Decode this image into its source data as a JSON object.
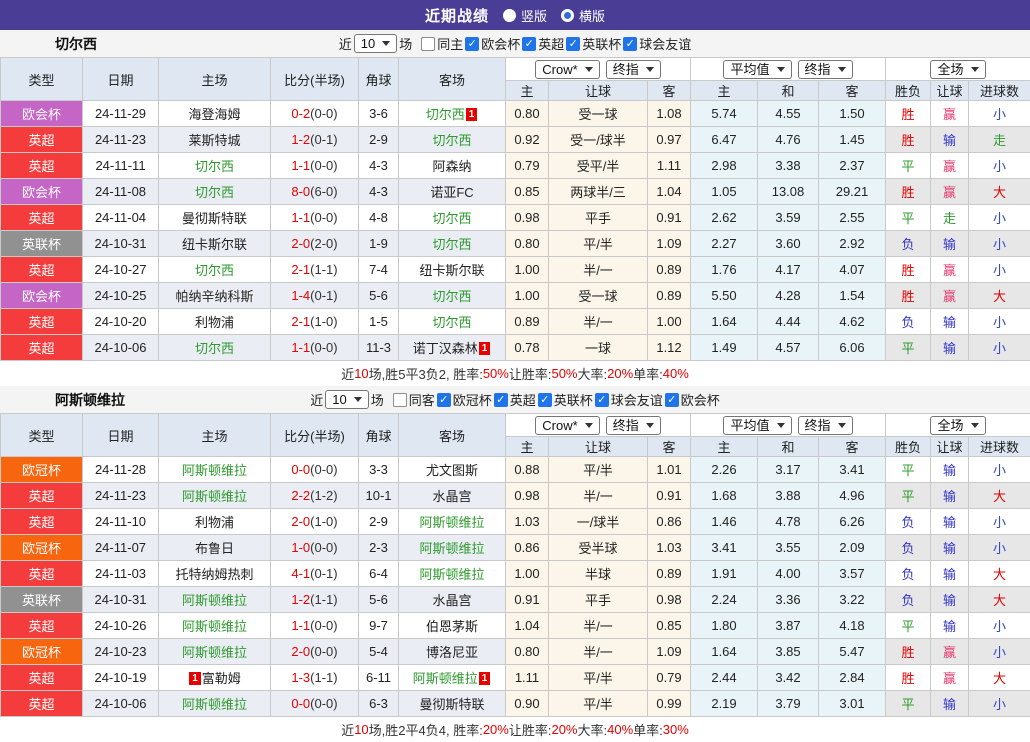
{
  "topbar": {
    "title": "近期战绩",
    "radio_vertical": "竖版",
    "radio_horizontal": "横版",
    "selected_layout": "横版"
  },
  "filters_common": {
    "near": "近",
    "count": "10",
    "unit": "场"
  },
  "table_headers": {
    "type": "类型",
    "date": "日期",
    "home": "主场",
    "score": "比分(半场)",
    "corner": "角球",
    "away": "客场",
    "bookmaker": "Crow*",
    "final_odds": "终指",
    "average": "平均值",
    "final_odds2": "终指",
    "fulltime": "全场",
    "home_odds": "主",
    "handicap": "让球",
    "away_odds": "客",
    "home_avg": "主",
    "draw_avg": "和",
    "away_avg": "客",
    "result": "胜负",
    "handicap_result": "让球",
    "goals": "进球数"
  },
  "colors": {
    "topbar_bg": "#4a3d96",
    "league": {
      "欧会杯": "#c565c5",
      "英超": "#f43c3c",
      "英联杯": "#919191",
      "欧冠杯": "#f7650f"
    },
    "result": {
      "胜": "#e60000",
      "平": "#2e9b2e",
      "负": "#3333cc"
    },
    "handicap": {
      "赢": "#e63c6e",
      "输": "#3333cc",
      "走": "#2e9b2e"
    },
    "goals": {
      "大": "#e60000",
      "小": "#3344cc",
      "走": "#2e9b2e"
    },
    "team_highlight": "#2e9b2e",
    "score_red": "#e60000",
    "badge_red": "#e60000"
  },
  "sections": [
    {
      "team": "切尔西",
      "same_venue": "同主",
      "same_checked": false,
      "leagues": [
        "欧会杯",
        "英超",
        "英联杯",
        "球会友谊"
      ],
      "rows": [
        {
          "league": "欧会杯",
          "date": "24-11-29",
          "home": "海登海姆",
          "home_hl": false,
          "score": "0-2",
          "half": "(0-0)",
          "corner": "3-6",
          "away": "切尔西",
          "away_hl": true,
          "away_badge": "1",
          "away_badge_pos": "after",
          "odds": [
            "0.80",
            "受一球",
            "1.08"
          ],
          "avg": [
            "5.74",
            "4.55",
            "1.50"
          ],
          "result": "胜",
          "handicap": "赢",
          "goals": "小"
        },
        {
          "league": "英超",
          "date": "24-11-23",
          "home": "莱斯特城",
          "home_hl": false,
          "score": "1-2",
          "half": "(0-1)",
          "corner": "2-9",
          "away": "切尔西",
          "away_hl": true,
          "odds": [
            "0.92",
            "受一/球半",
            "0.97"
          ],
          "avg": [
            "6.47",
            "4.76",
            "1.45"
          ],
          "result": "胜",
          "handicap": "输",
          "goals": "走"
        },
        {
          "league": "英超",
          "date": "24-11-11",
          "home": "切尔西",
          "home_hl": true,
          "score": "1-1",
          "half": "(0-0)",
          "corner": "4-3",
          "away": "阿森纳",
          "away_hl": false,
          "odds": [
            "0.79",
            "受平/半",
            "1.11"
          ],
          "avg": [
            "2.98",
            "3.38",
            "2.37"
          ],
          "result": "平",
          "handicap": "赢",
          "goals": "小"
        },
        {
          "league": "欧会杯",
          "date": "24-11-08",
          "home": "切尔西",
          "home_hl": true,
          "score": "8-0",
          "half": "(6-0)",
          "corner": "4-3",
          "away": "诺亚FC",
          "away_hl": false,
          "odds": [
            "0.85",
            "两球半/三",
            "1.04"
          ],
          "avg": [
            "1.05",
            "13.08",
            "29.21"
          ],
          "result": "胜",
          "handicap": "赢",
          "goals": "大"
        },
        {
          "league": "英超",
          "date": "24-11-04",
          "home": "曼彻斯特联",
          "home_hl": false,
          "score": "1-1",
          "half": "(0-0)",
          "corner": "4-8",
          "away": "切尔西",
          "away_hl": true,
          "odds": [
            "0.98",
            "平手",
            "0.91"
          ],
          "avg": [
            "2.62",
            "3.59",
            "2.55"
          ],
          "result": "平",
          "handicap": "走",
          "goals": "小"
        },
        {
          "league": "英联杯",
          "date": "24-10-31",
          "home": "纽卡斯尔联",
          "home_hl": false,
          "score": "2-0",
          "half": "(2-0)",
          "corner": "1-9",
          "away": "切尔西",
          "away_hl": true,
          "odds": [
            "0.80",
            "平/半",
            "1.09"
          ],
          "avg": [
            "2.27",
            "3.60",
            "2.92"
          ],
          "result": "负",
          "handicap": "输",
          "goals": "小"
        },
        {
          "league": "英超",
          "date": "24-10-27",
          "home": "切尔西",
          "home_hl": true,
          "score": "2-1",
          "half": "(1-1)",
          "corner": "7-4",
          "away": "纽卡斯尔联",
          "away_hl": false,
          "odds": [
            "1.00",
            "半/一",
            "0.89"
          ],
          "avg": [
            "1.76",
            "4.17",
            "4.07"
          ],
          "result": "胜",
          "handicap": "赢",
          "goals": "小"
        },
        {
          "league": "欧会杯",
          "date": "24-10-25",
          "home": "帕纳辛纳科斯",
          "home_hl": false,
          "score": "1-4",
          "half": "(0-1)",
          "corner": "5-6",
          "away": "切尔西",
          "away_hl": true,
          "odds": [
            "1.00",
            "受一球",
            "0.89"
          ],
          "avg": [
            "5.50",
            "4.28",
            "1.54"
          ],
          "result": "胜",
          "handicap": "赢",
          "goals": "大"
        },
        {
          "league": "英超",
          "date": "24-10-20",
          "home": "利物浦",
          "home_hl": false,
          "score": "2-1",
          "half": "(1-0)",
          "corner": "1-5",
          "away": "切尔西",
          "away_hl": true,
          "odds": [
            "0.89",
            "半/一",
            "1.00"
          ],
          "avg": [
            "1.64",
            "4.44",
            "4.62"
          ],
          "result": "负",
          "handicap": "输",
          "goals": "小"
        },
        {
          "league": "英超",
          "date": "24-10-06",
          "home": "切尔西",
          "home_hl": true,
          "score": "1-1",
          "half": "(0-0)",
          "corner": "11-3",
          "away": "诺丁汉森林",
          "away_hl": false,
          "away_badge": "1",
          "away_badge_pos": "after",
          "odds": [
            "0.78",
            "一球",
            "1.12"
          ],
          "avg": [
            "1.49",
            "4.57",
            "6.06"
          ],
          "result": "平",
          "handicap": "输",
          "goals": "小"
        }
      ],
      "summary": [
        {
          "t": "近",
          "r": false
        },
        {
          "t": "10",
          "r": true
        },
        {
          "t": "场,胜5平3负2, 胜率:",
          "r": false
        },
        {
          "t": "50%",
          "r": true
        },
        {
          "t": " 让胜率:",
          "r": false
        },
        {
          "t": "50%",
          "r": true
        },
        {
          "t": " 大率:",
          "r": false
        },
        {
          "t": "20%",
          "r": true
        },
        {
          "t": " 单率:",
          "r": false
        },
        {
          "t": "40%",
          "r": true
        }
      ]
    },
    {
      "team": "阿斯顿维拉",
      "same_venue": "同客",
      "same_checked": false,
      "leagues": [
        "欧冠杯",
        "英超",
        "英联杯",
        "球会友谊",
        "欧会杯"
      ],
      "rows": [
        {
          "league": "欧冠杯",
          "date": "24-11-28",
          "home": "阿斯顿维拉",
          "home_hl": true,
          "score": "0-0",
          "half": "(0-0)",
          "corner": "3-3",
          "away": "尤文图斯",
          "away_hl": false,
          "odds": [
            "0.88",
            "平/半",
            "1.01"
          ],
          "avg": [
            "2.26",
            "3.17",
            "3.41"
          ],
          "result": "平",
          "handicap": "输",
          "goals": "小"
        },
        {
          "league": "英超",
          "date": "24-11-23",
          "home": "阿斯顿维拉",
          "home_hl": true,
          "score": "2-2",
          "half": "(1-2)",
          "corner": "10-1",
          "away": "水晶宫",
          "away_hl": false,
          "odds": [
            "0.98",
            "半/一",
            "0.91"
          ],
          "avg": [
            "1.68",
            "3.88",
            "4.96"
          ],
          "result": "平",
          "handicap": "输",
          "goals": "大"
        },
        {
          "league": "英超",
          "date": "24-11-10",
          "home": "利物浦",
          "home_hl": false,
          "score": "2-0",
          "half": "(1-0)",
          "corner": "2-9",
          "away": "阿斯顿维拉",
          "away_hl": true,
          "odds": [
            "1.03",
            "一/球半",
            "0.86"
          ],
          "avg": [
            "1.46",
            "4.78",
            "6.26"
          ],
          "result": "负",
          "handicap": "输",
          "goals": "小"
        },
        {
          "league": "欧冠杯",
          "date": "24-11-07",
          "home": "布鲁日",
          "home_hl": false,
          "score": "1-0",
          "half": "(0-0)",
          "corner": "2-3",
          "away": "阿斯顿维拉",
          "away_hl": true,
          "odds": [
            "0.86",
            "受半球",
            "1.03"
          ],
          "avg": [
            "3.41",
            "3.55",
            "2.09"
          ],
          "result": "负",
          "handicap": "输",
          "goals": "小"
        },
        {
          "league": "英超",
          "date": "24-11-03",
          "home": "托特纳姆热刺",
          "home_hl": false,
          "score": "4-1",
          "half": "(0-1)",
          "corner": "6-4",
          "away": "阿斯顿维拉",
          "away_hl": true,
          "odds": [
            "1.00",
            "半球",
            "0.89"
          ],
          "avg": [
            "1.91",
            "4.00",
            "3.57"
          ],
          "result": "负",
          "handicap": "输",
          "goals": "大"
        },
        {
          "league": "英联杯",
          "date": "24-10-31",
          "home": "阿斯顿维拉",
          "home_hl": true,
          "score": "1-2",
          "half": "(1-1)",
          "corner": "5-6",
          "away": "水晶宫",
          "away_hl": false,
          "odds": [
            "0.91",
            "平手",
            "0.98"
          ],
          "avg": [
            "2.24",
            "3.36",
            "3.22"
          ],
          "result": "负",
          "handicap": "输",
          "goals": "大"
        },
        {
          "league": "英超",
          "date": "24-10-26",
          "home": "阿斯顿维拉",
          "home_hl": true,
          "score": "1-1",
          "half": "(0-0)",
          "corner": "9-7",
          "away": "伯恩茅斯",
          "away_hl": false,
          "odds": [
            "1.04",
            "半/一",
            "0.85"
          ],
          "avg": [
            "1.80",
            "3.87",
            "4.18"
          ],
          "result": "平",
          "handicap": "输",
          "goals": "小"
        },
        {
          "league": "欧冠杯",
          "date": "24-10-23",
          "home": "阿斯顿维拉",
          "home_hl": true,
          "score": "2-0",
          "half": "(0-0)",
          "corner": "5-4",
          "away": "博洛尼亚",
          "away_hl": false,
          "odds": [
            "0.80",
            "半/一",
            "1.09"
          ],
          "avg": [
            "1.64",
            "3.85",
            "5.47"
          ],
          "result": "胜",
          "handicap": "赢",
          "goals": "小"
        },
        {
          "league": "英超",
          "date": "24-10-19",
          "home": "富勒姆",
          "home_hl": false,
          "home_badge": "1",
          "home_badge_pos": "before",
          "score": "1-3",
          "half": "(1-1)",
          "corner": "6-11",
          "away": "阿斯顿维拉",
          "away_hl": true,
          "away_badge": "1",
          "away_badge_pos": "after",
          "odds": [
            "1.11",
            "平/半",
            "0.79"
          ],
          "avg": [
            "2.44",
            "3.42",
            "2.84"
          ],
          "result": "胜",
          "handicap": "赢",
          "goals": "大"
        },
        {
          "league": "英超",
          "date": "24-10-06",
          "home": "阿斯顿维拉",
          "home_hl": true,
          "score": "0-0",
          "half": "(0-0)",
          "corner": "6-3",
          "away": "曼彻斯特联",
          "away_hl": false,
          "odds": [
            "0.90",
            "平/半",
            "0.99"
          ],
          "avg": [
            "2.19",
            "3.79",
            "3.01"
          ],
          "result": "平",
          "handicap": "输",
          "goals": "小"
        }
      ],
      "summary": [
        {
          "t": "近",
          "r": false
        },
        {
          "t": "10",
          "r": true
        },
        {
          "t": "场,胜2平4负4, 胜率:",
          "r": false
        },
        {
          "t": "20%",
          "r": true
        },
        {
          "t": " 让胜率:",
          "r": false
        },
        {
          "t": "20%",
          "r": true
        },
        {
          "t": " 大率:",
          "r": false
        },
        {
          "t": "40%",
          "r": true
        },
        {
          "t": " 单率:",
          "r": false
        },
        {
          "t": "30%",
          "r": true
        }
      ]
    }
  ]
}
